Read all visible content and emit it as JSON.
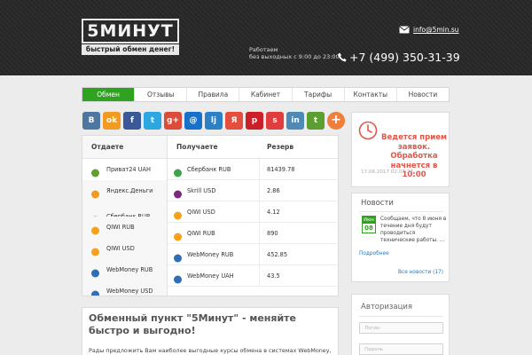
{
  "header": {
    "logo_text": "5МИНУТ",
    "logo_tagline": "быстрый обмен денег!",
    "worktime_line1": "Работаем",
    "worktime_line2": "без выходных с 9:00 до 23:00",
    "email": "info@5min.su",
    "phone": "+7 (499) 350-31-39"
  },
  "nav": [
    {
      "label": "Обмен",
      "active": true
    },
    {
      "label": "Отзывы",
      "active": false
    },
    {
      "label": "Правила",
      "active": false
    },
    {
      "label": "Кабинет",
      "active": false
    },
    {
      "label": "Тарифы",
      "active": false
    },
    {
      "label": "Контакты",
      "active": false
    },
    {
      "label": "Новости",
      "active": false
    }
  ],
  "share": [
    {
      "icon": "vkontakte-icon",
      "glyph": "B",
      "color": "#4d76a1"
    },
    {
      "icon": "odnoklassniki-icon",
      "glyph": "ok",
      "color": "#f39a22"
    },
    {
      "icon": "facebook-icon",
      "glyph": "f",
      "color": "#3b5998"
    },
    {
      "icon": "twitter-icon",
      "glyph": "t",
      "color": "#2ea7e0"
    },
    {
      "icon": "google-plus-icon",
      "glyph": "g+",
      "color": "#dd4b39"
    },
    {
      "icon": "mail-ru-icon",
      "glyph": "@",
      "color": "#1672c9"
    },
    {
      "icon": "livejournal-icon",
      "glyph": "lj",
      "color": "#2b81c4"
    },
    {
      "icon": "yandex-icon",
      "glyph": "Я",
      "color": "#e44e3c"
    },
    {
      "icon": "pinterest-icon",
      "glyph": "p",
      "color": "#cb2027"
    },
    {
      "icon": "surfingbird-icon",
      "glyph": "s",
      "color": "#e03d3f"
    },
    {
      "icon": "linkedin-icon",
      "glyph": "in",
      "color": "#4e8ab5"
    },
    {
      "icon": "tumblr-icon",
      "glyph": "t",
      "color": "#5b9e31"
    },
    {
      "icon": "plus-icon",
      "glyph": "+",
      "color": "#f07f3b"
    }
  ],
  "exchange": {
    "give_header": "Отдаете",
    "get_header": "Получаете",
    "reserve_header": "Резерв",
    "give": [
      {
        "label": "Приват24 UAH",
        "icon": "privat24-icon",
        "color": "#5fa02e"
      },
      {
        "label": "Яндекс.Деньги",
        "icon": "yandex-money-icon",
        "color": "#f29b1f"
      },
      {
        "label": "Сбербанк RUB",
        "icon": "sberbank-icon",
        "color": "#3fa34d"
      },
      {
        "label": "QIWI RUB",
        "icon": "qiwi-icon",
        "color": "#f7a11a"
      },
      {
        "label": "QIWI USD",
        "icon": "qiwi-icon",
        "color": "#f7a11a"
      },
      {
        "label": "WebMoney RUB",
        "icon": "webmoney-icon",
        "color": "#2f6db5"
      },
      {
        "label": "WebMoney USD",
        "icon": "webmoney-icon",
        "color": "#2f6db5"
      }
    ],
    "get": [
      {
        "label": "Сбербанк RUB",
        "reserve": "81439.78",
        "icon": "sberbank-icon",
        "color": "#3fa34d"
      },
      {
        "label": "Skrill USD",
        "reserve": "2.86",
        "icon": "skrill-icon",
        "color": "#7b2a7c"
      },
      {
        "label": "QIWI USD",
        "reserve": "4.12",
        "icon": "qiwi-icon",
        "color": "#f7a11a"
      },
      {
        "label": "QIWI RUB",
        "reserve": "890",
        "icon": "qiwi-icon",
        "color": "#f7a11a"
      },
      {
        "label": "WebMoney RUB",
        "reserve": "452.85",
        "icon": "webmoney-icon",
        "color": "#2f6db5"
      },
      {
        "label": "WebMoney UAH",
        "reserve": "43.5",
        "icon": "webmoney-icon",
        "color": "#2f6db5"
      }
    ]
  },
  "about": {
    "title": "Обменный пункт \"5Минут\" - меняйте быстро и выгодно!",
    "text": "Рады предложить Вам наиболее выгодные курсы обмена в системах WebMoney,"
  },
  "status": {
    "text": "Ведется прием заявок. Обработка начнется в 10:00",
    "datetime": "17.06.2017 02:03:24",
    "color": "#e25748"
  },
  "news": {
    "title": "Новости",
    "month": "Июн",
    "day": "08",
    "text": "Сообщаем, что 8 июня в течение дня будут проводиться технические работы. ...",
    "more": "Подробнее",
    "all": "Все новости (17)"
  },
  "auth": {
    "title": "Авторизация",
    "login_placeholder": "Логин",
    "password_placeholder": "Пароль"
  },
  "colors": {
    "accent_green": "#2fa320",
    "link_blue": "#2a7ab8"
  }
}
